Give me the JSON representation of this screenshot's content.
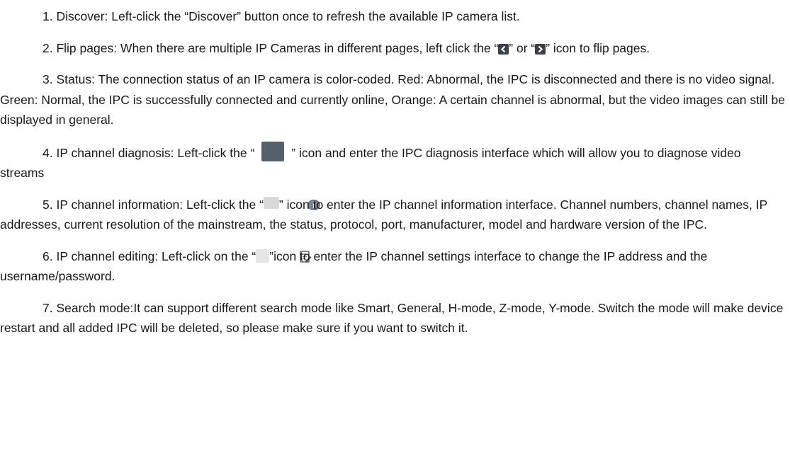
{
  "paragraphs": {
    "p1": "1. Discover: Left-click the “Discover” button once to refresh the available IP camera list.",
    "p2_a": "2. Flip pages: When there are multiple IP Cameras in different pages, left click the “",
    "p2_b": "” or “",
    "p2_c": "” icon to flip pages.",
    "p3": "3. Status: The connection status of an IP camera is color-coded.    Red: Abnormal, the IPC is disconnected and there is no video signal. Green: Normal, the IPC is successfully connected and currently online, Orange: A certain channel is abnormal, but the video images can still be displayed in general.",
    "p4_a": "4. IP channel diagnosis: Left-click the “",
    "p4_b": "” icon and enter the IPC diagnosis interface which will allow you to diagnose video streams",
    "p5_a": "5. IP channel information: Left-click the “",
    "p5_b": "” icon to enter the IP channel information interface. Channel numbers, channel names, IP addresses, current resolution of the mainstream, the status, protocol, port, manufacturer, model and hardware version of the IPC.",
    "p6_a": "6. IP channel editing: Left-click on the “",
    "p6_b": "”icon to enter the IP channel settings interface to change the IP address and the username/password.",
    "p7": "7. Search mode:It can support different search mode like Smart, General, H-mode, Z-mode, Y-mode. Switch the mode will make device restart and all added IPC will be deleted, so please make sure if you want to switch it."
  },
  "icons": {
    "prev": "chevron-left-icon",
    "next": "chevron-right-icon",
    "diagnosis": "stethoscope-icon",
    "info": "info-icon",
    "edit": "edit-icon"
  },
  "colors": {
    "text": "#1a1a1a",
    "icon_dark": "#3a3f4a",
    "icon_diag_bg": "#55606d",
    "icon_info_bg": "#d9d9d9",
    "icon_edit_bg": "#e6e6e6"
  }
}
